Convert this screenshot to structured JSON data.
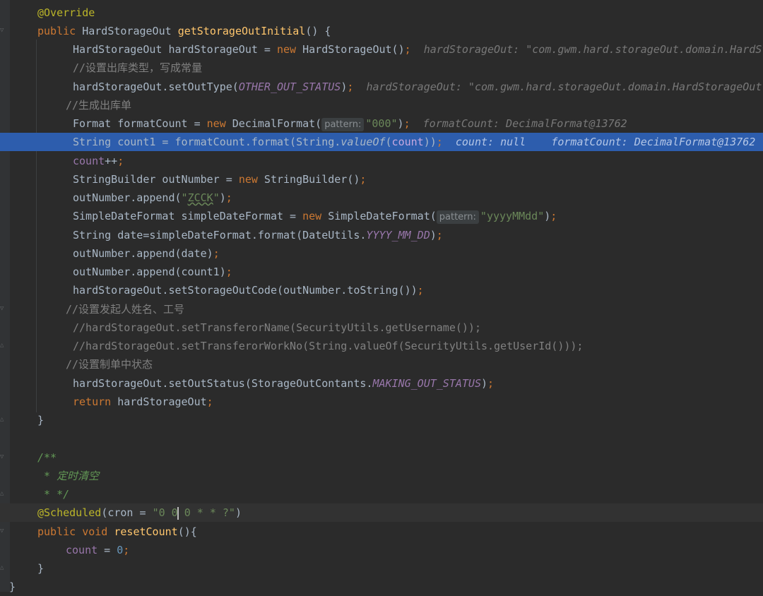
{
  "lines": {
    "l1": {
      "ann": "@Override"
    },
    "l2": {
      "kw": "public",
      "type": "HardStorageOut",
      "fn": "getStorageOutInitial",
      "rest": "() {"
    },
    "l3": {
      "t1": "HardStorageOut hardStorageOut = ",
      "kw": "new",
      "t2": " HardStorageOut()",
      "semi": ";",
      "inline": "hardStorageOut: \"com.gwm.hard.storageOut.domain.HardStorageOut\""
    },
    "l4": {
      "cmt": "//设置出库类型，写成常量"
    },
    "l5": {
      "t1": "hardStorageOut.setOutType(",
      "const": "OTHER_OUT_STATUS",
      "t2": ")",
      "semi": ";",
      "inline": "hardStorageOut: \"com.gwm.hard.storageOut.domain.HardStorageOut\""
    },
    "l6": {
      "cmt": "//生成出库单"
    },
    "l7": {
      "t1": "Format formatCount = ",
      "kw": "new",
      "t2": " DecimalFormat(",
      "hint": "pattern:",
      "str": "\"000\"",
      "t3": ")",
      "semi": ";",
      "inline": "formatCount: DecimalFormat@13762"
    },
    "l8": {
      "t1": "String count1 = formatCount.format(String.",
      "static": "valueOf",
      "t2": "(",
      "fld": "count",
      "t3": "))",
      "semi": ";",
      "inline1": "count: null",
      "inline2": "formatCount: DecimalFormat@13762"
    },
    "l9": {
      "fld": "count",
      "t1": "++",
      "semi": ";"
    },
    "l10": {
      "t1": "StringBuilder outNumber = ",
      "kw": "new",
      "t2": " StringBuilder()",
      "semi": ";"
    },
    "l11": {
      "t1": "outNumber.append(",
      "q1": "\"",
      "str": "ZCCK",
      "q2": "\"",
      "t2": ")",
      "semi": ";"
    },
    "l12": {
      "t1": "SimpleDateFormat simpleDateFormat = ",
      "kw": "new",
      "t2": " SimpleDateFormat(",
      "hint": "pattern:",
      "str": "\"yyyyMMdd\"",
      "t3": ")",
      "semi": ";"
    },
    "l13": {
      "t1": "String date=simpleDateFormat.format(DateUtils.",
      "const": "YYYY_MM_DD",
      "t2": ")",
      "semi": ";"
    },
    "l14": {
      "t1": "outNumber.append(date)",
      "semi": ";"
    },
    "l15": {
      "t1": "outNumber.append(count1)",
      "semi": ";"
    },
    "l16": {
      "t1": "hardStorageOut.setStorageOutCode(outNumber.toString())",
      "semi": ";"
    },
    "l17": {
      "cmt": "//设置发起人姓名、工号"
    },
    "l18": {
      "cmt": "//hardStorageOut.setTransferorName(SecurityUtils.getUsername());"
    },
    "l19": {
      "cmt": "//hardStorageOut.setTransferorWorkNo(String.valueOf(SecurityUtils.getUserId()));"
    },
    "l20": {
      "cmt": "//设置制单中状态"
    },
    "l21": {
      "t1": "hardStorageOut.setOutStatus(StorageOutContants.",
      "const": "MAKING_OUT_STATUS",
      "t2": ")",
      "semi": ";"
    },
    "l22": {
      "kw": "return",
      "t1": " hardStorageOut",
      "semi": ";"
    },
    "l23": {
      "t1": "}"
    },
    "l25": {
      "doc": "/**"
    },
    "l26": {
      "doc": " * 定时清空"
    },
    "l27": {
      "doc": " * */"
    },
    "l28": {
      "ann": "@Scheduled",
      "t1": "(cron = ",
      "str1": "\"0 0",
      "str2": " 0 * * ?\"",
      "t2": ")"
    },
    "l29": {
      "kw": "public",
      "kw2": "void",
      "fn": "resetCount",
      "rest": "(){"
    },
    "l30": {
      "fld": "count",
      "t1": " = ",
      "num": "0",
      "semi": ";"
    },
    "l31": {
      "t1": "}"
    },
    "l32": {
      "t1": "}"
    }
  }
}
